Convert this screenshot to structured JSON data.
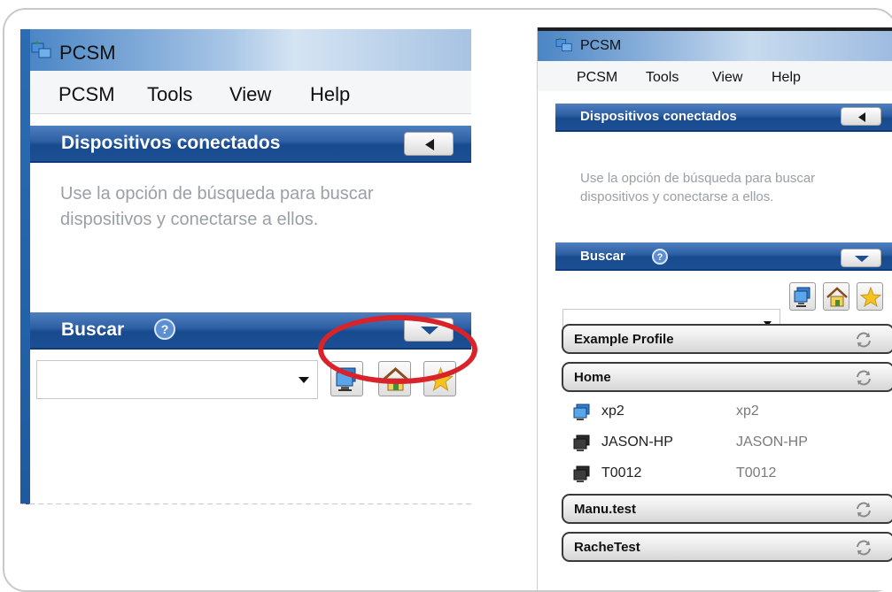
{
  "left_panel": {
    "app_title": "PCSM",
    "menu": [
      "PCSM",
      "Tools",
      "View",
      "Help"
    ],
    "connected_section": {
      "title": "Dispositivos conectados",
      "hint": "Use la opción de búsqueda para buscar dispositivos y conectarse a ellos."
    },
    "search_section": {
      "title": "Buscar"
    },
    "annotation": "red circle highlighting the search toolbar buttons"
  },
  "right_panel": {
    "app_title": "PCSM",
    "menu": [
      "PCSM",
      "Tools",
      "View",
      "Help"
    ],
    "connected_section": {
      "title": "Dispositivos conectados",
      "hint": "Use la opción de búsqueda para buscar dispositivos y conectarse a ellos."
    },
    "search_section": {
      "title": "Buscar"
    },
    "profiles": [
      {
        "name": "Example Profile"
      },
      {
        "name": "Home"
      },
      {
        "name": "Manu.test"
      },
      {
        "name": "RacheTest"
      }
    ],
    "devices": [
      {
        "name": "xp2",
        "host": "xp2",
        "icon": "computer-blue-icon"
      },
      {
        "name": "JASON-HP",
        "host": "JASON-HP",
        "icon": "computer-dark-icon"
      },
      {
        "name": "T0012",
        "host": "T0012",
        "icon": "computer-dark-icon"
      }
    ]
  },
  "icons": [
    "app-icon",
    "collapse-left-icon",
    "expand-down-icon",
    "help-icon",
    "dropdown-arrow-icon",
    "network-computer-icon",
    "home-icon",
    "favorites-star-icon",
    "refresh-icon"
  ],
  "colors": {
    "section_header": "#1d4f94",
    "highlight_ring": "#d8232a",
    "hint_text": "#9aa0a6"
  }
}
